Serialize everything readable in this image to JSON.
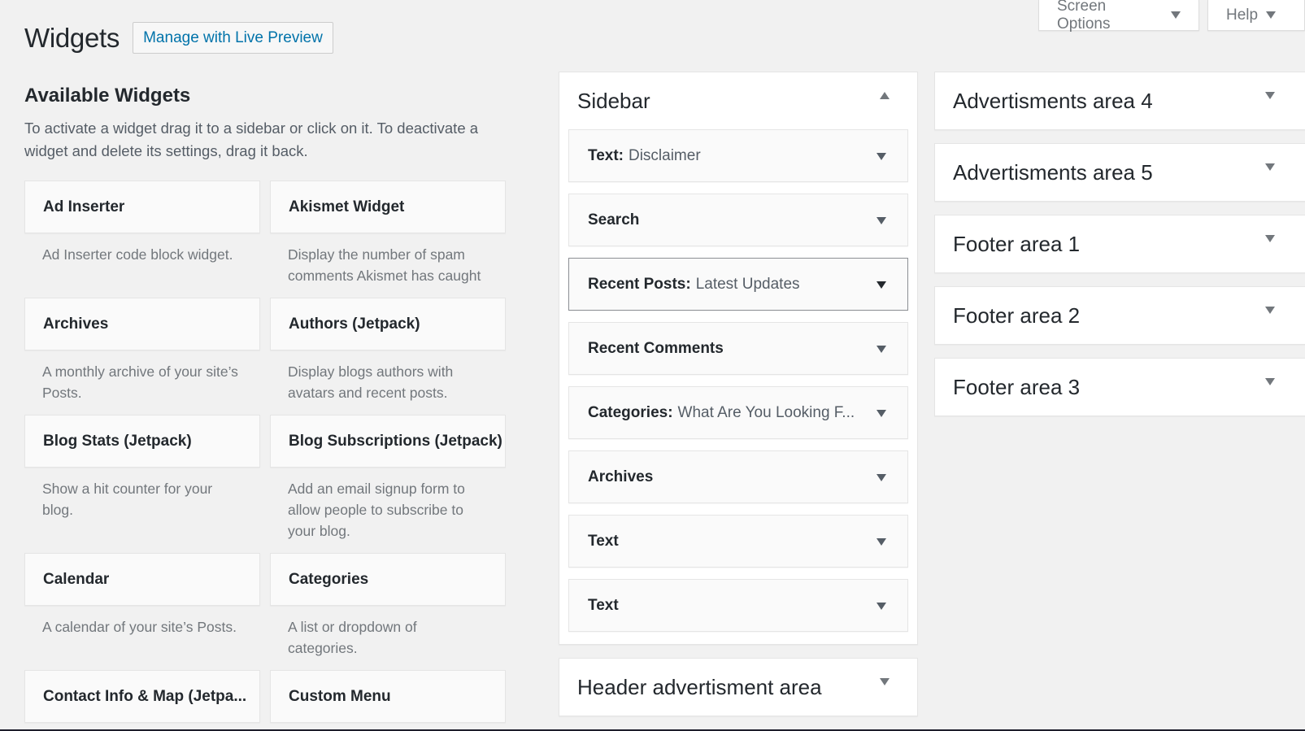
{
  "screen_meta": {
    "screen_options_label": "Screen Options",
    "help_label": "Help"
  },
  "header": {
    "title": "Widgets",
    "live_preview_label": "Manage with Live Preview",
    "link_color": "#0073aa"
  },
  "available": {
    "heading": "Available Widgets",
    "description": "To activate a widget drag it to a sidebar or click on it. To deactivate a widget and delete its settings, drag it back.",
    "widgets": [
      {
        "title": "Ad Inserter",
        "description": "Ad Inserter code block widget."
      },
      {
        "title": "Akismet Widget",
        "description": "Display the number of spam comments Akismet has caught"
      },
      {
        "title": "Archives",
        "description": "A monthly archive of your site’s Posts."
      },
      {
        "title": "Authors (Jetpack)",
        "description": "Display blogs authors with avatars and recent posts."
      },
      {
        "title": "Blog Stats (Jetpack)",
        "description": "Show a hit counter for your blog."
      },
      {
        "title": "Blog Subscriptions (Jetpack)",
        "description": "Add an email signup form to allow people to subscribe to your blog."
      },
      {
        "title": "Calendar",
        "description": "A calendar of your site’s Posts."
      },
      {
        "title": "Categories",
        "description": "A list or dropdown of categories."
      },
      {
        "title": "Contact Info & Map (Jetpa...",
        "description": ""
      },
      {
        "title": "Custom Menu",
        "description": ""
      }
    ]
  },
  "sidebars": {
    "main": {
      "name": "Sidebar",
      "expanded": true,
      "widgets": [
        {
          "title": "Text:",
          "subtitle": "Disclaimer"
        },
        {
          "title": "Search",
          "subtitle": ""
        },
        {
          "title": "Recent Posts:",
          "subtitle": "Latest Updates",
          "focused": true
        },
        {
          "title": "Recent Comments",
          "subtitle": ""
        },
        {
          "title": "Categories:",
          "subtitle": "What Are You Looking F..."
        },
        {
          "title": "Archives",
          "subtitle": ""
        },
        {
          "title": "Text",
          "subtitle": ""
        },
        {
          "title": "Text",
          "subtitle": ""
        }
      ]
    },
    "header_ad": {
      "name": "Header advertisment area"
    },
    "right": [
      {
        "name": "Advertisments area 4"
      },
      {
        "name": "Advertisments area 5"
      },
      {
        "name": "Footer area 1"
      },
      {
        "name": "Footer area 2"
      },
      {
        "name": "Footer area 3"
      }
    ]
  }
}
